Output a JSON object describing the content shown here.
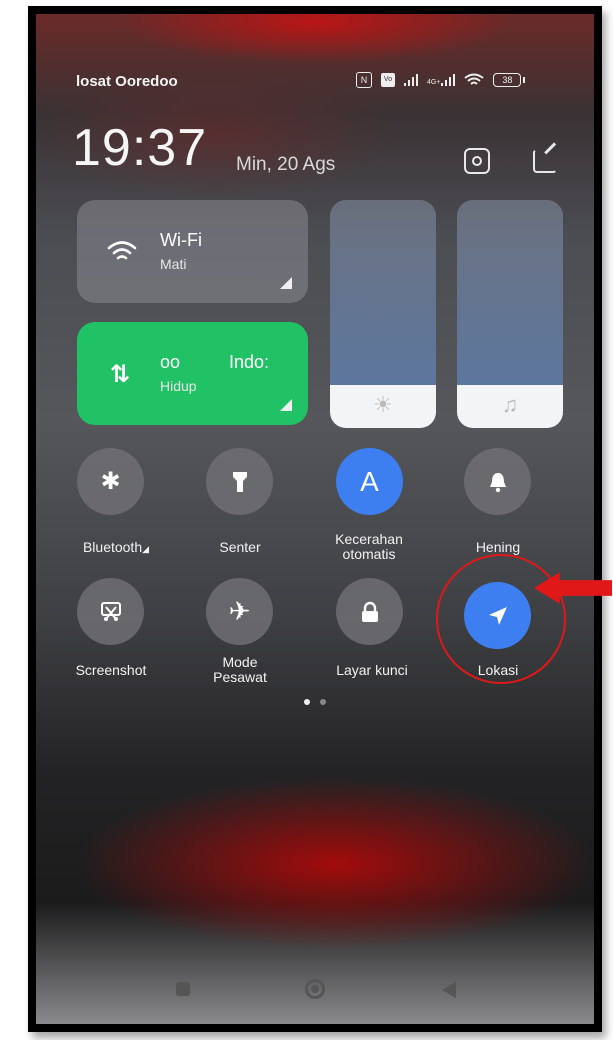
{
  "status_bar": {
    "carrier": "losat Ooredoo",
    "icons": [
      "nfc-icon",
      "volte-icon",
      "signal-icon",
      "4g-signal-icon",
      "wifi-icon"
    ],
    "network_label": "4G+",
    "battery": "38"
  },
  "header": {
    "time": "19:37",
    "date": "Min, 20 Ags"
  },
  "tiles": {
    "wifi": {
      "title": "Wi-Fi",
      "status": "Mati"
    },
    "data": {
      "title_left": "oo",
      "title_right": "Indo:",
      "status": "Hidup"
    }
  },
  "sliders": {
    "brightness": {
      "icon": "sun-icon",
      "level": 0.19
    },
    "volume": {
      "icon": "music-note-icon",
      "level": 0.19
    }
  },
  "toggles": [
    {
      "label": "Bluetooth",
      "icon": "bluetooth-icon",
      "active": false
    },
    {
      "label": "Senter",
      "icon": "flashlight-icon",
      "active": false
    },
    {
      "label": "Kecerahan otomatis",
      "icon": "auto-brightness-icon",
      "glyph": "A",
      "active": true
    },
    {
      "label": "Hening",
      "icon": "bell-icon",
      "active": false
    },
    {
      "label": "Screenshot",
      "icon": "screenshot-icon",
      "active": false
    },
    {
      "label": "Mode Pesawat",
      "icon": "airplane-icon",
      "active": false
    },
    {
      "label": "Layar kunci",
      "icon": "lock-icon",
      "active": false
    },
    {
      "label": "Lokasi",
      "icon": "location-icon",
      "active": true
    }
  ],
  "labels": {
    "bluetooth": "Bluetooth",
    "senter": "Senter",
    "kecerahan_1": "Kecerahan",
    "kecerahan_2": "otomatis",
    "hening": "Hening",
    "screenshot": "Screenshot",
    "mode_1": "Mode",
    "mode_2": "Pesawat",
    "layar": "Layar kunci",
    "lokasi": "Lokasi"
  },
  "page_indicator": {
    "current": 1,
    "total": 2
  },
  "colors": {
    "accent_blue": "#3d7ff0",
    "data_green": "#21c265",
    "annotation_red": "#e01818"
  }
}
